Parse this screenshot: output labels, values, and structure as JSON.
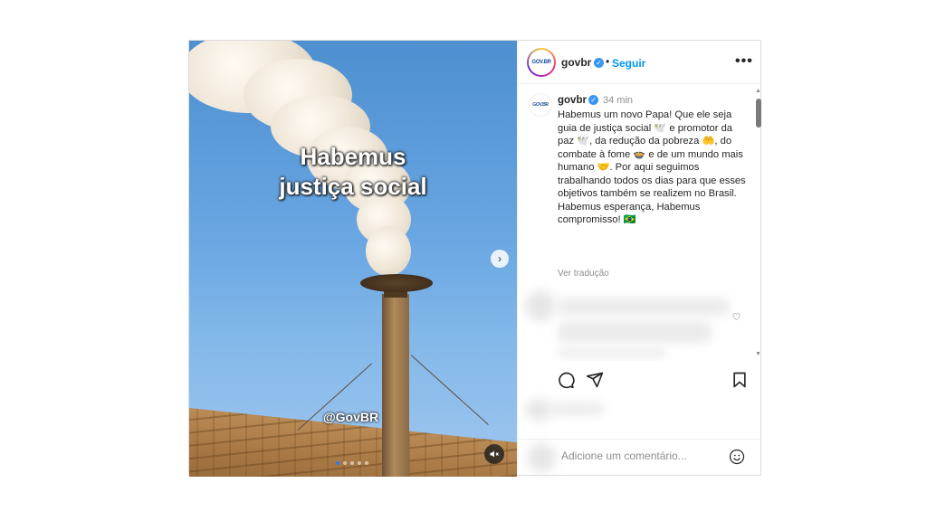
{
  "media": {
    "caption_line1": "Habemus",
    "caption_line2": "justiça social",
    "watermark": "@GovBR",
    "next_arrow": "›",
    "slide_count": 5,
    "active_slide": 1
  },
  "header": {
    "avatar_logo": "GOV.BR",
    "username": "govbr",
    "verified_icon": "✓",
    "separator": "•",
    "follow_label": "Seguir",
    "more_label": "•••"
  },
  "post": {
    "username": "govbr",
    "time": "34 min",
    "caption": "Habemus um novo Papa! Que ele seja guia de justiça social 🕊️ e promotor da paz 🕊️, da redução da pobreza 🤲, do combate à fome 🍲 e de um mundo mais humano 🤝. Por aqui seguimos trabalhando todos os dias para que esses objetivos também se realizem no Brasil. Habemus esperança, Habemus compromisso! 🇧🇷",
    "translate_label": "Ver tradução"
  },
  "actions": {
    "comment_icon": "comment-icon",
    "share_icon": "share-icon",
    "save_icon": "bookmark-icon"
  },
  "comment_box": {
    "placeholder": "Adicione um comentário...",
    "emoji_icon": "emoji-icon"
  }
}
